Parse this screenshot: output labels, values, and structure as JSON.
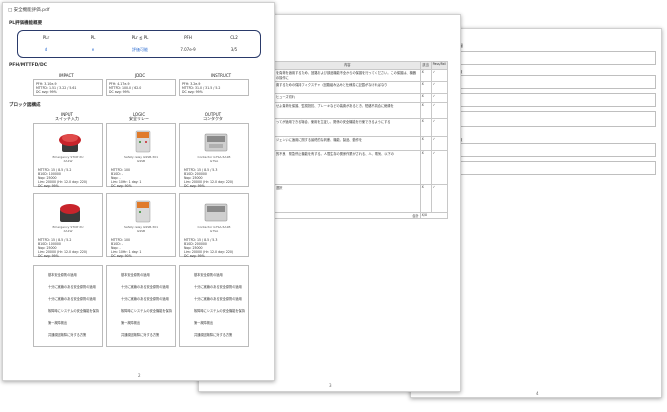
{
  "page3": {
    "header": "い情報",
    "field_labels": [
      "情報",
      "情報"
    ],
    "page_number": "4"
  },
  "page2": {
    "header": "ェック)",
    "table": {
      "columns": [
        "内容",
        "該当",
        "Pass/Fail"
      ],
      "rows": [
        {
          "text": "を負荷を適用するため、回路および部品機能不全からの保護を行ってください。この保護は、機器の操作に",
          "c1": "X",
          "c2": "✓"
        },
        {
          "text": "置するための保持フィクスチャ（回路組み込みと仕様書に記載がなければなり",
          "c1": "X",
          "c2": "✓"
        },
        {
          "text": "ヒューズ切れ",
          "c1": "X",
          "c2": "✓"
        },
        {
          "text": "せよ負荷を保護、監視抵抗、ブレーキなどの装置があるとき、短絡不具合に絶縁を",
          "c1": "X",
          "c2": "✓"
        },
        {
          "text": "ってが適用できる場合、使用を立証し、関係の安全機能を行使できるようにする",
          "c1": "X",
          "c2": "✓"
        },
        {
          "text": "ジェンいに適用に関する最終的な判断、機能、製品、動作を",
          "c1": "X",
          "c2": "✓"
        },
        {
          "text": "的不良　緊急停止機能を有する。人間生存の関係作業がされる、人、電気、以下の",
          "c1": "X",
          "c2": "✓"
        },
        {
          "text": "選択",
          "c1": "X",
          "c2": "✓"
        }
      ],
      "footer": [
        "合計",
        "X/X"
      ]
    },
    "page_number": "3"
  },
  "page1": {
    "file_title": "□ 安全機能評価.pdf",
    "section1": "PL評価機能概要",
    "pill_columns": [
      "PLr",
      "PL",
      "PLr ≦ PL",
      "PFH",
      "CL2"
    ],
    "pill_values": [
      "d",
      "e",
      "評価可能",
      "7.07e-9",
      "3/5"
    ],
    "section2": "PFH/MTTFD/DC",
    "std_headers": [
      "IMPACT",
      "JDDC",
      "INSTRUCT"
    ],
    "std_boxes": [
      [
        "PFH: 3.10e-9",
        "MTTFD: 1.51 / 3.22 / 5.61",
        "DC avg: 99%"
      ],
      [
        "PFH: 4.17e-9",
        "MTTFD: 100.0 / 62.0",
        "DC avg: 99%"
      ],
      [
        "PFH: 3.2e-9",
        "MTTFD: 31.0 / 31.5 / 5.2",
        "DC avg: 99%"
      ]
    ],
    "section3": "ブロック図構成",
    "block_headers": [
      "INPUT\nスイッチ入力",
      "LOGIC\n安全リレー",
      "OUTPUT\nコンタクタ"
    ],
    "cards_row1": [
      {
        "caption": "Emergency STOP XU\nXA1W",
        "specs": [
          "MTTFD: 15 / 8.5 / 5.2",
          "B10D: 100000",
          "Nop: 25000",
          "Lim: 20000 (Hr: 12.0 day: 220)",
          "DC avg: 99%"
        ]
      },
      {
        "caption": "Safety relay G9SB-301\nG9SB",
        "specs": [
          "MTTFD: 100",
          "B10D: -",
          "Nop: -",
          "Lim: 10Hr: 1 day: 1",
          "DC avg: 90%"
        ]
      },
      {
        "caption": "Contactor G7SA-5A1B\nG7SA",
        "specs": [
          "MTTFD: 15 / 8.5 / 5.3",
          "B10D: 200000",
          "Nop: 25000",
          "Lim: 20000 (Hr: 12.0 day: 220)",
          "DC avg: 99%"
        ]
      }
    ],
    "cards_row2": [
      {
        "caption": "Emergency STOP XU\nXA1W",
        "specs": [
          "MTTFD: 15 / 8.5 / 5.2",
          "B10D: 100000",
          "Nop: 25000",
          "Lim: 20000 (Hr: 12.0 day: 220)",
          "DC avg: 99%"
        ]
      },
      {
        "caption": "Safety relay G9SB-301\nG9SB",
        "specs": [
          "MTTFD: 100",
          "B10D: -",
          "Nop: -",
          "Lim: 10Hr: 1 day: 1",
          "DC avg: 90%"
        ]
      },
      {
        "caption": "Contactor G7SA-5A1B\nG7SA",
        "specs": [
          "MTTFD: 15 / 8.5 / 5.3",
          "B10D: 200000",
          "Nop: 25000",
          "Lim: 20000 (Hr: 12.0 day: 220)",
          "DC avg: 99%"
        ]
      }
    ],
    "lists": [
      [
        "基本安全原則の適用",
        "十分に実績のある安全原則の適用",
        "十分に実績のある安全原則の適用",
        "故障時にシステムの安全機能を保持",
        "第一故障検出",
        "共通原因故障に対する方策"
      ],
      [
        "基本安全原則の適用",
        "十分に実績のある安全原則の適用",
        "十分に実績のある安全原則の適用",
        "故障時にシステムの安全機能を保持",
        "第一故障検出",
        "共通原因故障に対する方策"
      ],
      [
        "基本安全原則の適用",
        "十分に実績のある安全原則の適用",
        "十分に実績のある安全原則の適用",
        "故障時にシステムの安全機能を保持",
        "第一故障検出",
        "共通原因故障に対する方策"
      ]
    ],
    "page_number": "2"
  },
  "colors": {
    "accent": "#2b6bd0",
    "pill_border": "#2a3a6a",
    "stop_red": "#c8242b",
    "relay_orange": "#e07a2a"
  }
}
